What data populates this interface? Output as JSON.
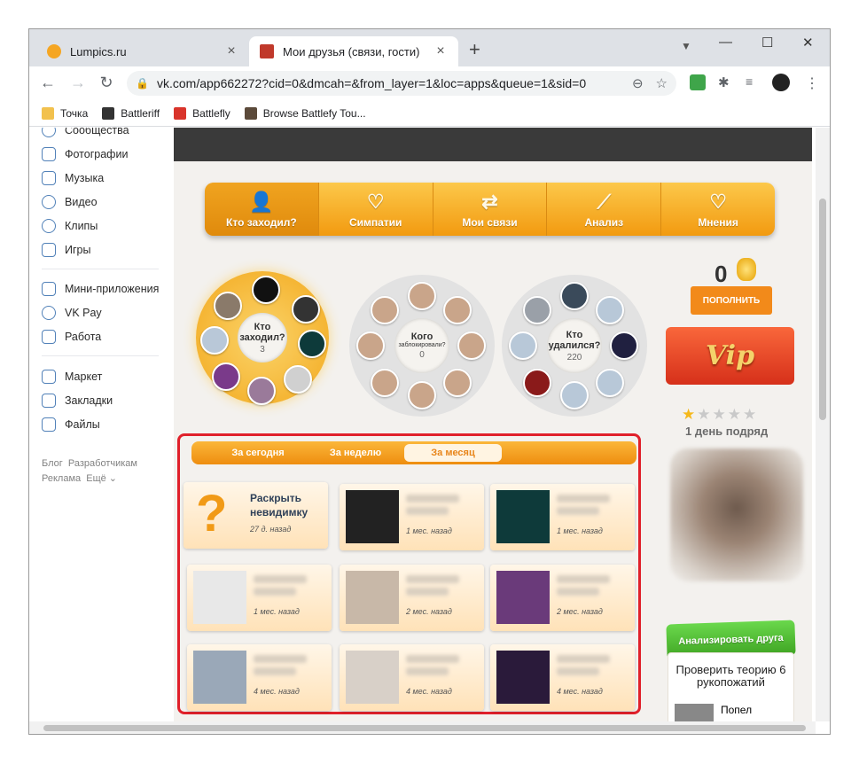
{
  "browser": {
    "tabs": [
      {
        "title": "Lumpics.ru",
        "close": "×"
      },
      {
        "title": "Мои друзья (связи, гости)",
        "close": "×"
      }
    ],
    "new_tab": "+",
    "window_controls": [
      "—",
      "☐",
      "✕"
    ],
    "nav": {
      "back": "←",
      "forward": "→",
      "reload": "↻"
    },
    "url": "vk.com/app662272?cid=0&dmcah=&from_layer=1&loc=apps&queue=1&sid=0",
    "bookmarks": [
      "Точка",
      "Battleriff",
      "Battlefly",
      "Browse Battlefy Tou..."
    ]
  },
  "sidebar": {
    "items": [
      {
        "label": "Сообщества"
      },
      {
        "label": "Фотографии"
      },
      {
        "label": "Музыка"
      },
      {
        "label": "Видео"
      },
      {
        "label": "Клипы"
      },
      {
        "label": "Игры"
      },
      {
        "label": "Мини-приложения"
      },
      {
        "label": "VK Pay"
      },
      {
        "label": "Работа"
      },
      {
        "label": "Маркет"
      },
      {
        "label": "Закладки"
      },
      {
        "label": "Файлы"
      }
    ],
    "footer": {
      "blog": "Блог",
      "dev": "Разработчикам",
      "ads": "Реклама",
      "more": "Ещё ⌄"
    }
  },
  "app": {
    "menu": [
      {
        "label": "Кто заходил?",
        "icon": "user-icon"
      },
      {
        "label": "Симпатии",
        "icon": "heart-icon"
      },
      {
        "label": "Мои связи",
        "icon": "link-icon"
      },
      {
        "label": "Анализ",
        "icon": "chart-icon"
      },
      {
        "label": "Мнения",
        "icon": "heart-icon"
      }
    ],
    "circles": [
      {
        "title": "Кто заходил?",
        "count": "3"
      },
      {
        "title": "Кого",
        "subtitle": "заблокировали?",
        "count": "0"
      },
      {
        "title": "Кто удалился?",
        "count": "220"
      }
    ],
    "coins": "0",
    "topup": "ПОПОЛНИТЬ",
    "vip": "Vip",
    "streak": "1 день подряд",
    "analyze": "Анализировать друга",
    "theory": {
      "text": "Проверить теорию 6 рукопожатий",
      "mini": "Попел"
    },
    "period_tabs": [
      "За сегодня",
      "За неделю",
      "За месяц"
    ],
    "reveal": {
      "title": "Раскрыть невидимку",
      "when": "27 д. назад"
    },
    "visitors": [
      {
        "when": "1 мес. назад"
      },
      {
        "when": "1 мес. назад"
      },
      {
        "when": "1 мес. назад"
      },
      {
        "when": "2 мес. назад"
      },
      {
        "when": "2 мес. назад"
      },
      {
        "when": "4 мес. назад"
      },
      {
        "when": "4 мес. назад"
      },
      {
        "when": "4 мес. назад"
      }
    ]
  }
}
